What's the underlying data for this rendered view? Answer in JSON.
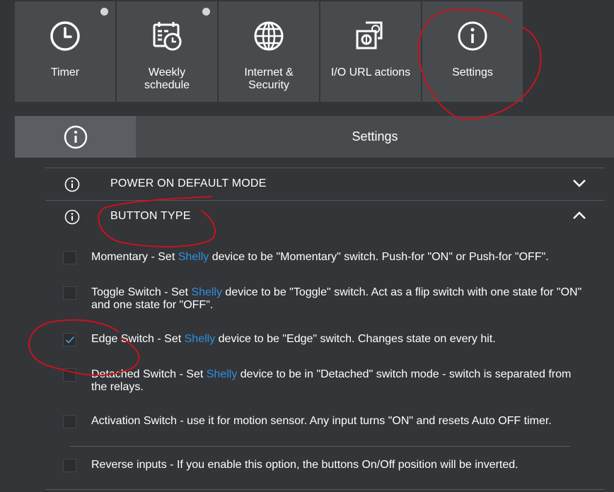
{
  "nav": [
    {
      "label": "Timer",
      "icon": "clock-icon",
      "dot": true
    },
    {
      "label": "Weekly\nschedule",
      "icon": "calendar-icon",
      "dot": true
    },
    {
      "label": "Internet &\nSecurity",
      "icon": "globe-icon",
      "dot": false
    },
    {
      "label": "I/O URL actions",
      "icon": "io-url-icon",
      "dot": false
    },
    {
      "label": "Settings",
      "icon": "info-icon",
      "dot": false
    }
  ],
  "panel": {
    "title": "Settings",
    "icon": "info-icon"
  },
  "sections": {
    "power_on": {
      "title": "POWER ON DEFAULT MODE",
      "expanded": false
    },
    "button_type": {
      "title": "BUTTON TYPE",
      "expanded": true
    }
  },
  "options": [
    {
      "name": "Momentary",
      "pre": "Momentary - Set ",
      "brand": "Shelly",
      "post": " device to be \"Momentary\" switch. Push-for \"ON\" or Push-for \"OFF\".",
      "checked": false
    },
    {
      "name": "Toggle Switch",
      "pre": "Toggle Switch - Set ",
      "brand": "Shelly",
      "post": " device to be \"Toggle\" switch. Act as a flip switch with one state for \"ON\" and one state for \"OFF\".",
      "checked": false
    },
    {
      "name": "Edge Switch",
      "pre": "Edge Switch - Set ",
      "brand": "Shelly",
      "post": " device to be \"Edge\" switch. Changes state on every hit.",
      "checked": true
    },
    {
      "name": "Detached Switch",
      "pre": "Detached Switch - Set ",
      "brand": "Shelly",
      "post": " device to be in \"Detached\" switch mode - switch is separated from the relays.",
      "checked": false
    },
    {
      "name": "Activation Switch",
      "pre": "Activation Switch - use it for motion sensor. Any input turns \"ON\" and resets Auto OFF timer.",
      "brand": "",
      "post": "",
      "checked": false
    }
  ],
  "reverse": {
    "text": "Reverse inputs - If you enable this option, the buttons On/Off position will be inverted.",
    "checked": false
  },
  "colors": {
    "background": "#333538",
    "tile": "#484b4e",
    "brand_link": "#2f8fe0",
    "annotation": "#c8141e"
  }
}
